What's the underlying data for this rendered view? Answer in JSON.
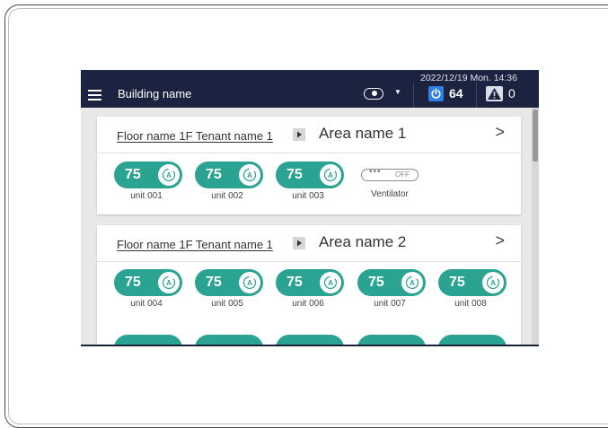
{
  "header": {
    "building_name": "Building name",
    "datetime": "2022/12/19 Mon. 14:36",
    "power_count": "64",
    "warning_count": "0",
    "colors": {
      "bar": "#1b2340",
      "power": "#2d7fe0",
      "unit": "#2aa393"
    }
  },
  "areas": [
    {
      "floor_tenant": "Floor name 1F Tenant name 1",
      "area_name": "Area name 1",
      "units": [
        {
          "temp": "75",
          "name": "unit 001",
          "mode_icon": "auto-mode-icon"
        },
        {
          "temp": "75",
          "name": "unit 002",
          "mode_icon": "auto-mode-icon"
        },
        {
          "temp": "75",
          "name": "unit 003",
          "mode_icon": "auto-mode-icon"
        }
      ],
      "ventilator": {
        "dots": "•••",
        "state": "OFF",
        "name": "Ventilator"
      }
    },
    {
      "floor_tenant": "Floor name 1F Tenant name 1",
      "area_name": "Area name 2",
      "units": [
        {
          "temp": "75",
          "name": "unit 004",
          "mode_icon": "auto-mode-icon"
        },
        {
          "temp": "75",
          "name": "unit 005",
          "mode_icon": "auto-mode-icon"
        },
        {
          "temp": "75",
          "name": "unit 006",
          "mode_icon": "auto-mode-icon"
        },
        {
          "temp": "75",
          "name": "unit 007",
          "mode_icon": "auto-mode-icon"
        },
        {
          "temp": "75",
          "name": "unit 008",
          "mode_icon": "auto-mode-icon"
        }
      ]
    }
  ]
}
